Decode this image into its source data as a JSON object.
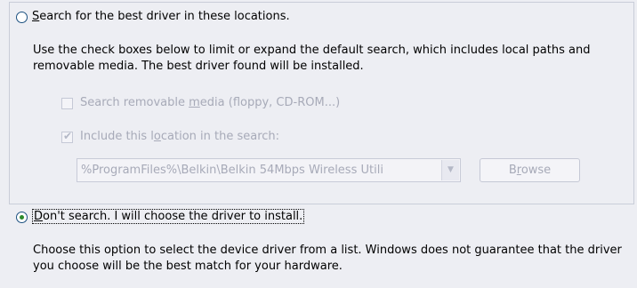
{
  "search_option": {
    "label_prefix": "",
    "label_accel": "S",
    "label_rest": "earch for the best driver in these locations.",
    "selected": false,
    "description": "Use the check boxes below to limit or expand the default search, which includes local paths and removable media. The best driver found will be installed."
  },
  "removable_media": {
    "label_prefix": "Search removable ",
    "label_accel": "m",
    "label_rest": "edia (floppy, CD-ROM...)",
    "checked": false,
    "enabled": false
  },
  "include_location": {
    "label_prefix": "Include this l",
    "label_accel": "o",
    "label_rest": "cation in the search:",
    "checked": true,
    "enabled": false
  },
  "location_combo": {
    "value": "%ProgramFiles%\\Belkin\\Belkin 54Mbps Wireless Utili",
    "enabled": false
  },
  "browse_button": {
    "label_prefix": "B",
    "label_accel": "r",
    "label_rest": "owse",
    "enabled": false
  },
  "dont_search_option": {
    "label_prefix": "",
    "label_accel": "D",
    "label_rest": "on't search. I will choose the driver to install.",
    "selected": true,
    "description": "Choose this option to select the device driver from a list. Windows does not guarantee that the driver you choose will be the best match for your hardware."
  },
  "colors": {
    "background": "#edeef3",
    "disabled_text": "#a7aab8",
    "radio_dot": "#2c8b2c"
  }
}
